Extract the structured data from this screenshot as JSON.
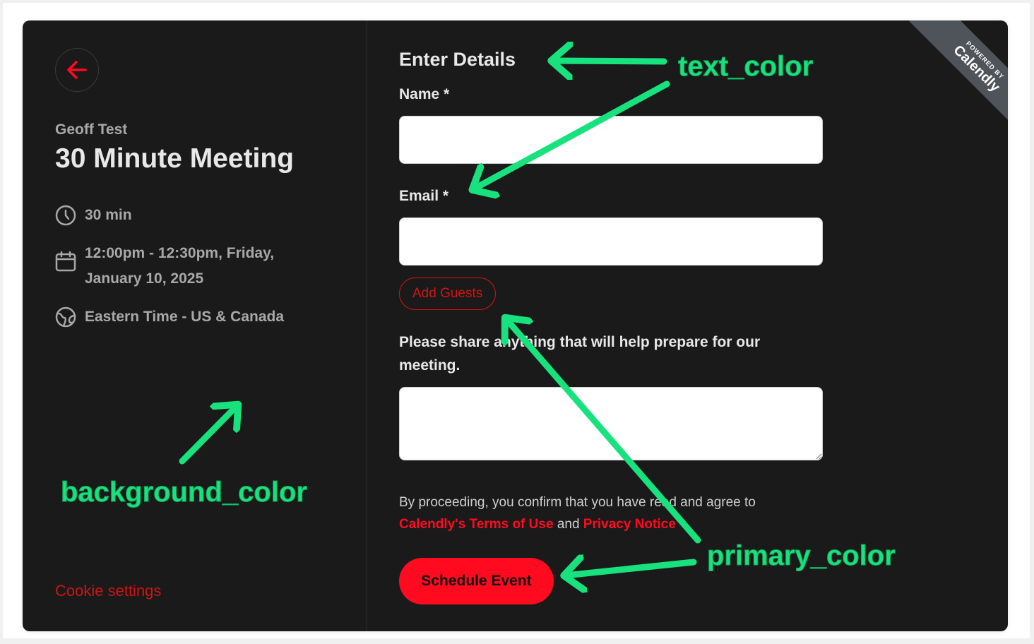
{
  "event": {
    "organizer": "Geoff Test",
    "title": "30 Minute Meeting",
    "duration": "30 min",
    "datetime_line1": "12:00pm - 12:30pm, Friday,",
    "datetime_line2": "January 10, 2025",
    "timezone": "Eastern Time - US & Canada"
  },
  "footer": {
    "cookie_settings": "Cookie settings"
  },
  "form": {
    "title": "Enter Details",
    "name_label": "Name *",
    "name_value": "",
    "email_label": "Email *",
    "email_value": "",
    "add_guests": "Add Guests",
    "prompt": "Please share anything that will help prepare for our meeting.",
    "notes_value": "",
    "legal_prefix": "By proceeding, you confirm that you have read and agree to",
    "terms_link": "Calendly's Terms of Use",
    "legal_and": "and",
    "privacy_link": "Privacy Notice",
    "schedule_button": "Schedule Event"
  },
  "badge": {
    "powered_by": "POWERED BY",
    "brand": "Calendly"
  },
  "annotations": {
    "text_color": "text_color",
    "background_color": "background_color",
    "primary_color": "primary_color"
  },
  "colors": {
    "background": "#1a1a1a",
    "text": "#e8e8e8",
    "primary": "#ff0a1f",
    "annotation": "#18e27d"
  },
  "icons": {
    "back": "arrow-left-icon",
    "duration": "clock-icon",
    "datetime": "calendar-icon",
    "timezone": "globe-icon"
  }
}
